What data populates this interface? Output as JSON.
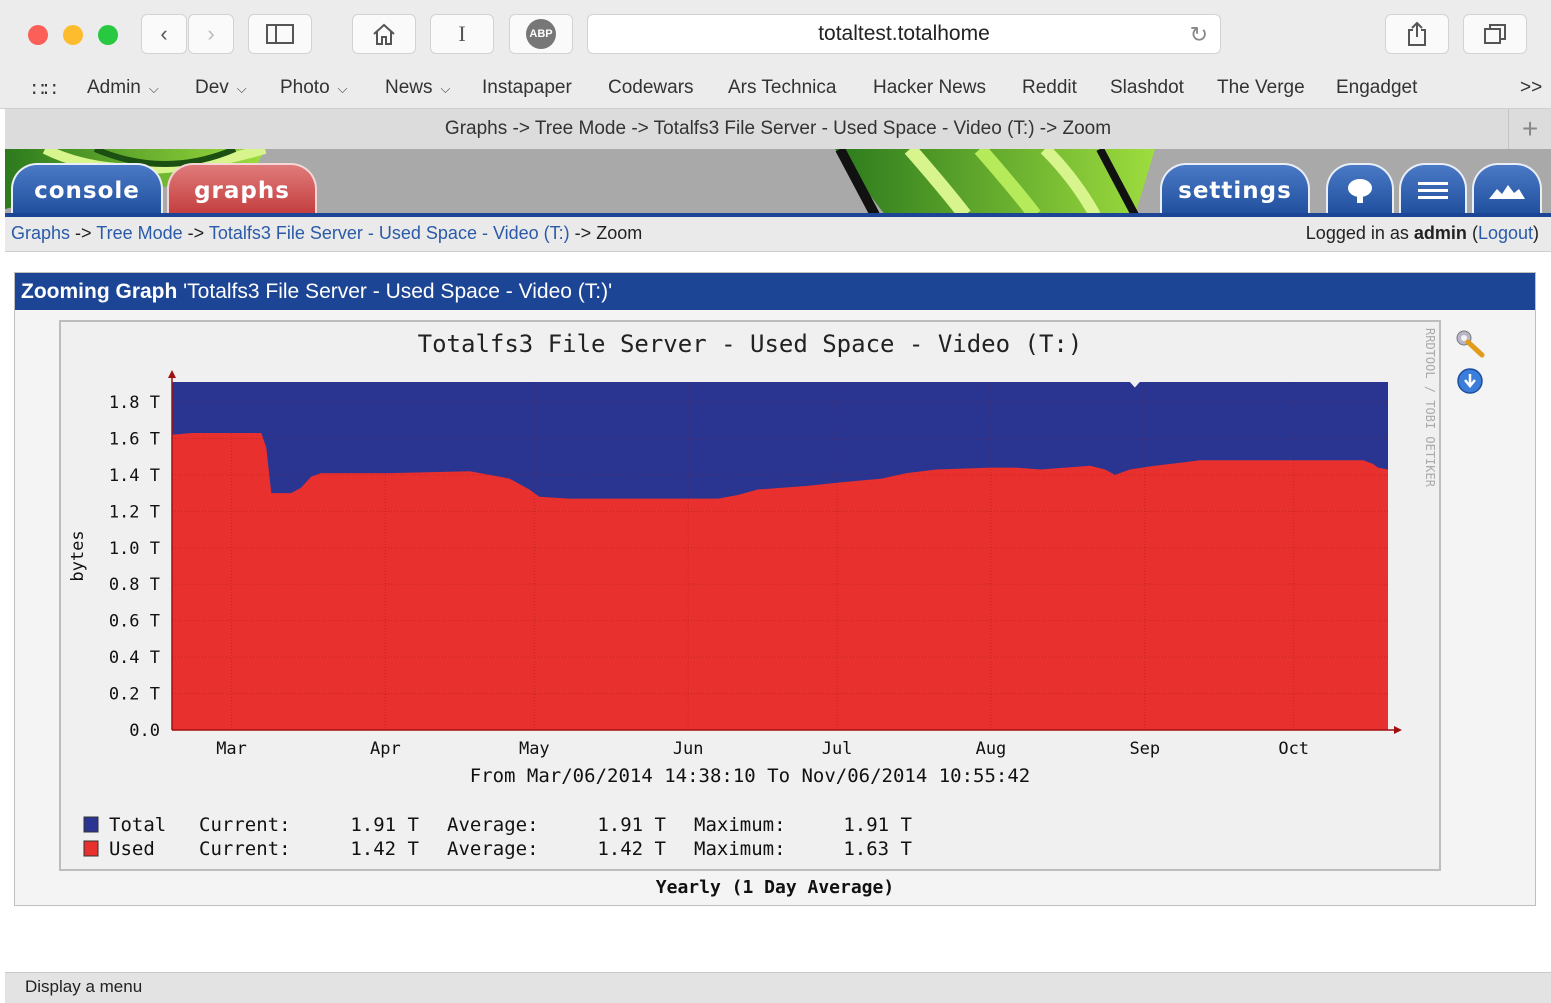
{
  "browser": {
    "url": "totaltest.totalhome",
    "tab_title": "Graphs -> Tree Mode -> Totalfs3 File Server - Used Space - Video (T:) -> Zoom",
    "adblock_label": "ABP",
    "bookmarks": [
      {
        "label": "Admin",
        "dropdown": true
      },
      {
        "label": "Dev",
        "dropdown": true
      },
      {
        "label": "Photo",
        "dropdown": true
      },
      {
        "label": "News",
        "dropdown": true
      },
      {
        "label": "Instapaper",
        "dropdown": false
      },
      {
        "label": "Codewars",
        "dropdown": false
      },
      {
        "label": "Ars Technica",
        "dropdown": false
      },
      {
        "label": "Hacker News",
        "dropdown": false
      },
      {
        "label": "Reddit",
        "dropdown": false
      },
      {
        "label": "Slashdot",
        "dropdown": false
      },
      {
        "label": "The Verge",
        "dropdown": false
      },
      {
        "label": "Engadget",
        "dropdown": false
      }
    ],
    "overflow_label": ">>",
    "status_text": "Display a menu"
  },
  "cacti": {
    "tabs": {
      "console": "console",
      "graphs": "graphs",
      "settings": "settings"
    },
    "breadcrumb": {
      "graphs": "Graphs",
      "sep": "->",
      "tree": "Tree Mode",
      "item": "Totalfs3 File Server - Used Space - Video (T:)",
      "current": "Zoom"
    },
    "login": {
      "prefix": "Logged in as",
      "user": "admin",
      "logout": "Logout"
    },
    "panel_title_bold": "Zooming Graph",
    "panel_title_rest": "'Totalfs3 File Server - Used Space - Video (T:)'",
    "caption": "Yearly (1 Day Average)"
  },
  "colors": {
    "total": "#2a3591",
    "used": "#e8302e",
    "header_blue": "#1d4595",
    "link": "#2a5aa8"
  },
  "chart_data": {
    "type": "area",
    "title": "Totalfs3 File Server - Used Space - Video (T:)",
    "ylabel": "bytes",
    "watermark": "RRDTOOL / TOBI OETIKER",
    "time_range": "From Mar/06/2014 14:38:10 To Nov/06/2014 10:55:42",
    "ylim": [
      0,
      1.91
    ],
    "ytick_labels": [
      "0.0",
      "0.2 T",
      "0.4 T",
      "0.6 T",
      "0.8 T",
      "1.0 T",
      "1.2 T",
      "1.4 T",
      "1.6 T",
      "1.8 T"
    ],
    "ytick_values": [
      0,
      0.2,
      0.4,
      0.6,
      0.8,
      1.0,
      1.2,
      1.4,
      1.6,
      1.8
    ],
    "x_labels": [
      "Mar",
      "Apr",
      "May",
      "Jun",
      "Jul",
      "Aug",
      "Sep",
      "Oct"
    ],
    "x_label_days": [
      12,
      43,
      73,
      104,
      134,
      165,
      196,
      226
    ],
    "x_max_days": 245,
    "series": [
      {
        "name": "Total",
        "points": [
          [
            0,
            1.91
          ],
          [
            193,
            1.91
          ],
          [
            194,
            1.88
          ],
          [
            195,
            1.91
          ],
          [
            245,
            1.91
          ]
        ]
      },
      {
        "name": "Used",
        "points": [
          [
            0,
            1.62
          ],
          [
            4,
            1.63
          ],
          [
            18,
            1.63
          ],
          [
            19,
            1.55
          ],
          [
            20,
            1.3
          ],
          [
            24,
            1.3
          ],
          [
            26,
            1.33
          ],
          [
            28,
            1.39
          ],
          [
            30,
            1.41
          ],
          [
            44,
            1.41
          ],
          [
            60,
            1.42
          ],
          [
            64,
            1.4
          ],
          [
            68,
            1.38
          ],
          [
            72,
            1.32
          ],
          [
            74,
            1.28
          ],
          [
            80,
            1.27
          ],
          [
            110,
            1.27
          ],
          [
            114,
            1.29
          ],
          [
            118,
            1.32
          ],
          [
            128,
            1.34
          ],
          [
            135,
            1.36
          ],
          [
            143,
            1.38
          ],
          [
            148,
            1.41
          ],
          [
            154,
            1.43
          ],
          [
            165,
            1.44
          ],
          [
            170,
            1.44
          ],
          [
            175,
            1.43
          ],
          [
            180,
            1.44
          ],
          [
            185,
            1.45
          ],
          [
            188,
            1.43
          ],
          [
            190,
            1.4
          ],
          [
            193,
            1.43
          ],
          [
            198,
            1.45
          ],
          [
            201,
            1.46
          ],
          [
            204,
            1.47
          ],
          [
            207,
            1.48
          ],
          [
            240,
            1.48
          ],
          [
            242,
            1.46
          ],
          [
            243,
            1.44
          ],
          [
            245,
            1.43
          ]
        ]
      }
    ],
    "legend": [
      {
        "name": "Total",
        "current_label": "Current:",
        "current": "1.91 T",
        "average_label": "Average:",
        "average": "1.91 T",
        "maximum_label": "Maximum:",
        "maximum": "1.91 T"
      },
      {
        "name": "Used",
        "current_label": "Current:",
        "current": "1.42 T",
        "average_label": "Average:",
        "average": "1.42 T",
        "maximum_label": "Maximum:",
        "maximum": "1.63 T"
      }
    ]
  }
}
